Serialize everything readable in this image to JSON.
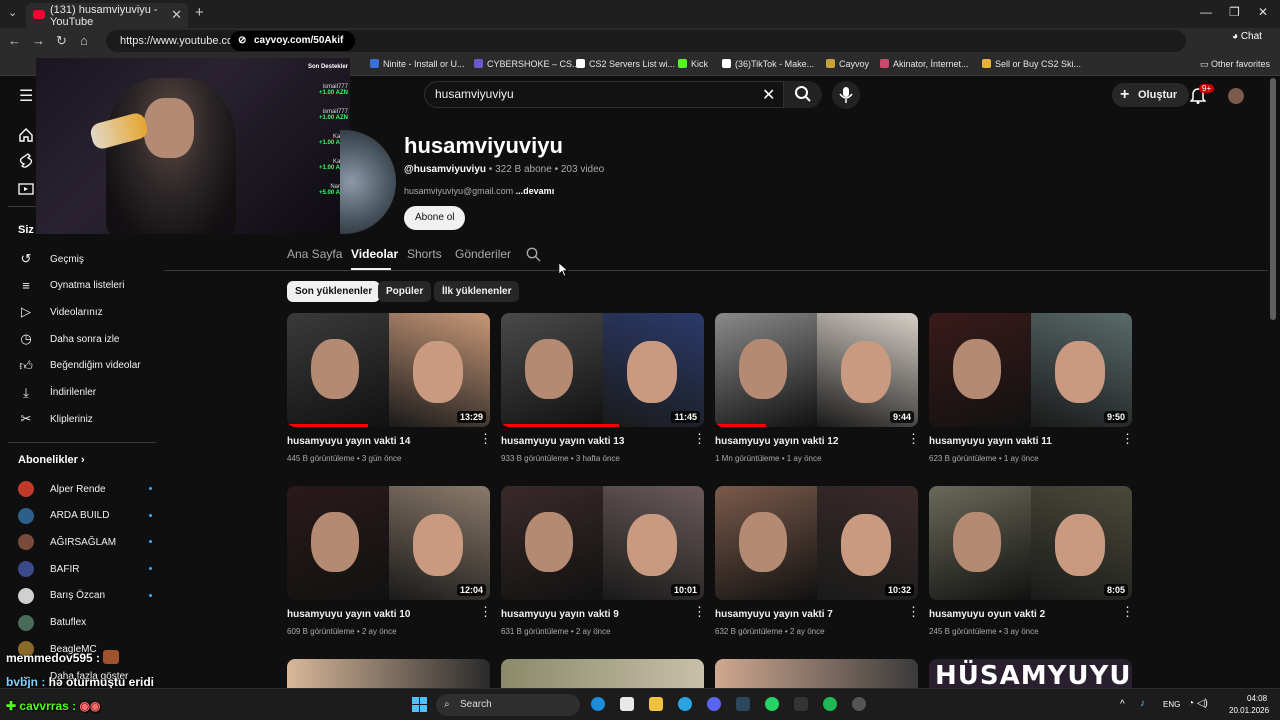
{
  "browser": {
    "tab_title": "(131) husamviyuviyu - YouTube",
    "url": "https://www.youtube.com/",
    "overlay_pill": "cayvoy.com/50Akif",
    "chat_button": "Chat",
    "bookmarks": [
      {
        "label": "Ninite - Install or U...",
        "color": "#3a6fd8"
      },
      {
        "label": "CYBERSHOKE – CS...",
        "color": "#6a5acd"
      },
      {
        "label": "CS2 Servers List wi...",
        "color": "#ffffff"
      },
      {
        "label": "Kick",
        "color": "#53fc18"
      },
      {
        "label": "(36)TikTok - Make...",
        "color": "#ffffff"
      },
      {
        "label": "Cayvoy",
        "color": "#c8a13a"
      },
      {
        "label": "Akinator, İnternet...",
        "color": "#c94a6a"
      },
      {
        "label": "Sell or Buy CS2 Ski...",
        "color": "#e8b23a"
      }
    ],
    "other_favorites": "Other favorites"
  },
  "header": {
    "search_value": "husamviyuviyu",
    "create_label": "Oluştur",
    "notif_badge": "9+"
  },
  "sidebar": {
    "you_heading": "Siz",
    "you_items": [
      {
        "label": "Geçmiş",
        "icon": "history-icon"
      },
      {
        "label": "Oynatma listeleri",
        "icon": "playlist-icon"
      },
      {
        "label": "Videolarınız",
        "icon": "your-videos-icon"
      },
      {
        "label": "Daha sonra izle",
        "icon": "watch-later-icon"
      },
      {
        "label": "Beğendiğim videolar",
        "icon": "thumbs-up-icon"
      },
      {
        "label": "İndirilenler",
        "icon": "download-icon"
      },
      {
        "label": "Klipleriniz",
        "icon": "scissors-icon"
      }
    ],
    "subs_heading": "Abonelikler",
    "subs": [
      {
        "label": "Alper Rende",
        "color": "#c0392b"
      },
      {
        "label": "ARDA BUILD",
        "color": "#2c5f8a"
      },
      {
        "label": "AĞIRSAĞLAM",
        "color": "#7a4a3a"
      },
      {
        "label": "BAFIR",
        "color": "#3a4a8a"
      },
      {
        "label": "Barış Özcan",
        "color": "#d0d0d0"
      },
      {
        "label": "Batuflex",
        "color": "#4a6a5a"
      },
      {
        "label": "BeagleMC",
        "color": "#8a6a2a"
      }
    ],
    "more_label": "Daha fazla göster"
  },
  "stream_overlay": {
    "donors_title": "Son Destekler",
    "donors": [
      {
        "name": "ismail777",
        "amount": "+1.00 AZN"
      },
      {
        "name": "ismail777",
        "amount": "+1.00 AZN"
      },
      {
        "name": "Kamil",
        "amount": "+1.00 AZN"
      },
      {
        "name": "Kamil",
        "amount": "+1.00 AZN"
      },
      {
        "name": "Narmy",
        "amount": "+5.00 AZN"
      }
    ]
  },
  "channel": {
    "name": "husamviyuviyu",
    "handle": "@husamviyuviyu",
    "stats": " • 322 B abone • 203 video",
    "email": "husamviyuviyu@gmail.com ",
    "more": "...devamı",
    "subscribe_label": "Abone ol"
  },
  "tabs": [
    "Ana Sayfa",
    "Videolar",
    "Shorts",
    "Gönderiler"
  ],
  "chips": [
    "Son yüklenenler",
    "Popüler",
    "İlk yüklenenler"
  ],
  "videos": [
    {
      "title": "husamyuyu yayın vakti 14",
      "meta": "445 B görüntüleme • 3 gün önce",
      "duration": "13:29",
      "left": "#3a3a3a",
      "right": "#c89878"
    },
    {
      "title": "husamyuyu yayın vakti 13",
      "meta": "933 B görüntüleme • 3 hafta önce",
      "duration": "11:45",
      "left": "#4a4a4a",
      "right": "#2a3a6a"
    },
    {
      "title": "husamyuyu yayın vakti 12",
      "meta": "1 Mn görüntüleme • 1 ay önce",
      "duration": "9:44",
      "left": "#8a8a8a",
      "right": "#d8d0c8"
    },
    {
      "title": "husamyuyu yayın vakti 11",
      "meta": "623 B görüntüleme • 1 ay önce",
      "duration": "9:50",
      "left": "#3a1a1a",
      "right": "#5a6a6a"
    },
    {
      "title": "husamyuyu yayın vakti 10",
      "meta": "609 B görüntüleme • 2 ay önce",
      "duration": "12:04",
      "left": "#2a1a1a",
      "right": "#8a7a6a"
    },
    {
      "title": "husamyuyu yayın vakti 9",
      "meta": "631 B görüntüleme • 2 ay önce",
      "duration": "10:01",
      "left": "#3a2a2a",
      "right": "#6a5a5a"
    },
    {
      "title": "husamyuyu yayın vakti 7",
      "meta": "632 B görüntüleme • 2 ay önce",
      "duration": "10:32",
      "left": "#7a5a4a",
      "right": "#3a2a2a"
    },
    {
      "title": "husamyuyu oyun vakti 2",
      "meta": "245 B görüntüleme • 3 ay önce",
      "duration": "8:05",
      "left": "#6a6a5a",
      "right": "#4a4a3a"
    }
  ],
  "partial_row_banner": "HÜSAMYUYU",
  "chat": [
    {
      "user": "memmedov595 :",
      "msg": ""
    },
    {
      "user": "bvbjn :",
      "msg": "hə oturmuştu eridi"
    },
    {
      "user": "cavvrras :",
      "msg": ""
    }
  ],
  "taskbar": {
    "search_label": "Search",
    "lang": "ENG",
    "time": "04:08",
    "date": "20.01.2026"
  }
}
